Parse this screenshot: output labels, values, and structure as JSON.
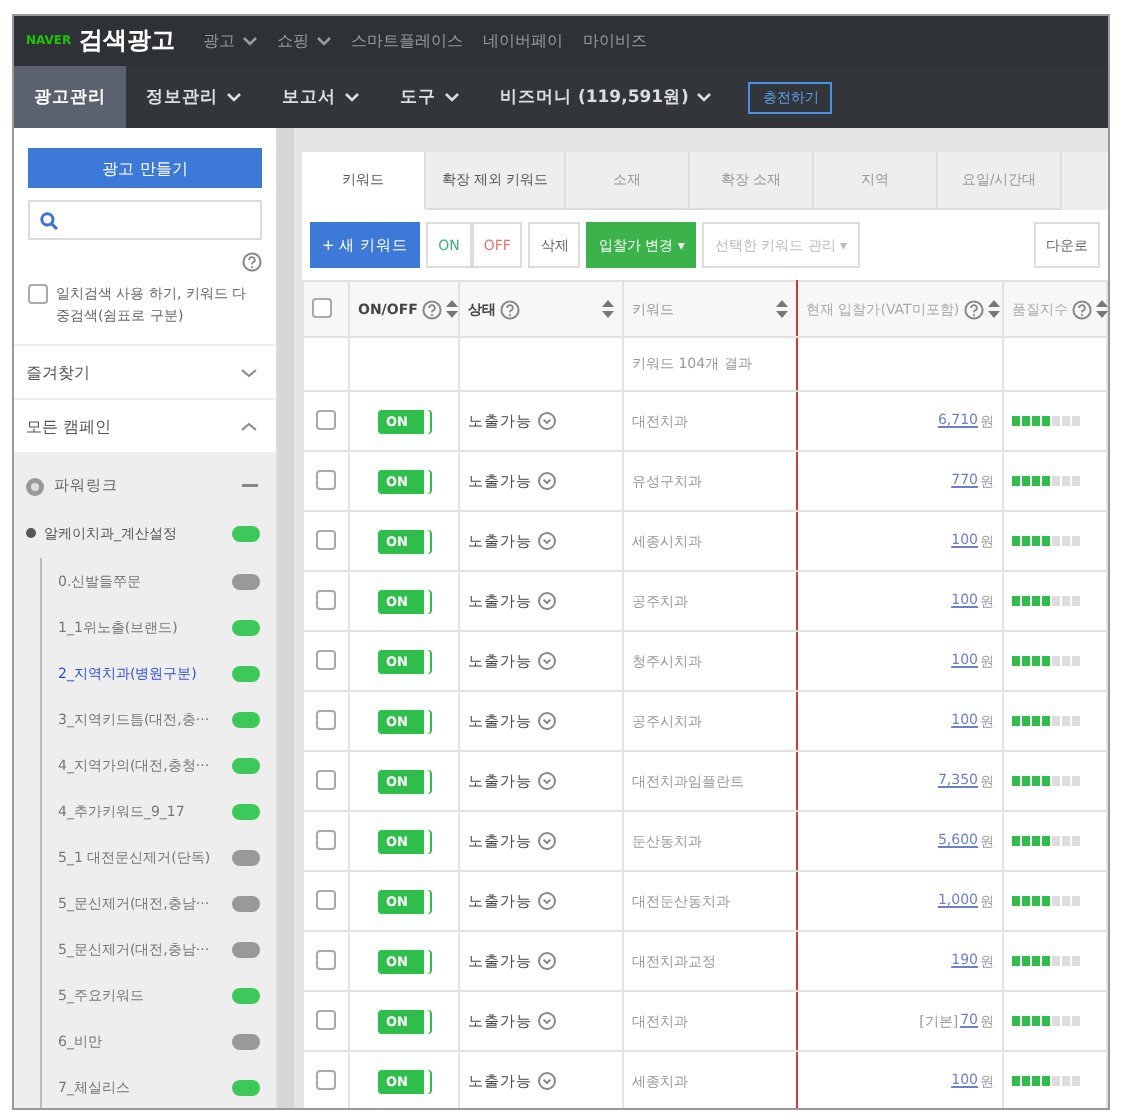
{
  "top_bar": {
    "logo_brand": "NAVER",
    "logo_title": "검색광고",
    "menu": [
      {
        "label": "광고",
        "dropdown": true
      },
      {
        "label": "쇼핑",
        "dropdown": true
      },
      {
        "label": "스마트플레이스",
        "dropdown": false
      },
      {
        "label": "네이버페이",
        "dropdown": false
      },
      {
        "label": "마이비즈",
        "dropdown": false
      }
    ]
  },
  "nav_bar": {
    "items": [
      {
        "label": "광고관리",
        "selected": true,
        "dropdown": false
      },
      {
        "label": "정보관리",
        "selected": false,
        "dropdown": true
      },
      {
        "label": "보고서",
        "selected": false,
        "dropdown": true
      },
      {
        "label": "도구",
        "selected": false,
        "dropdown": true
      },
      {
        "label": "비즈머니 (119,591원)",
        "selected": false,
        "dropdown": true
      }
    ],
    "charge_button": "충전하기"
  },
  "sidebar": {
    "create_button": "광고 만들기",
    "option": {
      "checked": false,
      "label": "일치검색 사용 하기, 키워드 다중검색(쉼표로 구분)"
    },
    "sections": [
      {
        "label": "즐겨찾기",
        "expanded": false
      },
      {
        "label": "모든 캠페인",
        "expanded": true
      }
    ],
    "campaign": {
      "label": "파워링크",
      "expanded": true
    },
    "items": [
      {
        "label": "알케이치과_계산설정",
        "on": true,
        "selected": false,
        "children": [
          {
            "label": "0.신발들쭈문",
            "on": false,
            "selected": false
          },
          {
            "label": "1_1위노출(브랜드)",
            "on": true,
            "selected": false
          },
          {
            "label": "2_지역치과(병원구분)",
            "on": true,
            "selected": true
          },
          {
            "label": "3_지역키드틈(대전,충···",
            "on": true,
            "selected": false
          },
          {
            "label": "4_지역가의(대전,충청···",
            "on": true,
            "selected": false
          },
          {
            "label": "4_추가키워드_9_17",
            "on": true,
            "selected": false
          },
          {
            "label": "5_1 대전문신제거(단독)",
            "on": false,
            "selected": false
          },
          {
            "label": "5_문신제거(대전,충남···",
            "on": false,
            "selected": false
          },
          {
            "label": "5_문신제거(대전,충남···",
            "on": false,
            "selected": false
          },
          {
            "label": "5_주요키워드",
            "on": true,
            "selected": false
          },
          {
            "label": "6_비만",
            "on": false,
            "selected": false
          },
          {
            "label": "7_체실리스",
            "on": true,
            "selected": false
          }
        ]
      }
    ]
  },
  "tabs": [
    {
      "label": "키워드",
      "selected": true
    },
    {
      "label": "확장 제외 키워드",
      "selected": false
    },
    {
      "label": "소재",
      "selected": false
    },
    {
      "label": "확장 소재",
      "selected": false
    },
    {
      "label": "지역",
      "selected": false
    },
    {
      "label": "요일/시간대",
      "selected": false
    }
  ],
  "toolbar": [
    {
      "kind": "primary",
      "label": "+ 새 키워드"
    },
    {
      "kind": "on",
      "label": "ON"
    },
    {
      "kind": "off",
      "label": "OFF"
    },
    {
      "kind": "plain",
      "label": "삭제"
    },
    {
      "kind": "green",
      "label": "입찰가 변경 ▾"
    },
    {
      "kind": "disabled",
      "label": "선택한 키워드 관리 ▾"
    },
    {
      "kind": "plain",
      "label": "다운로"
    }
  ],
  "table": {
    "columns": [
      {
        "label": "ON/OFF",
        "help": true,
        "sort": true,
        "highlighted": false
      },
      {
        "label": "상태",
        "help": true,
        "sort": true,
        "highlighted": false
      },
      {
        "label": "키워드",
        "help": false,
        "sort": true,
        "highlighted": true
      },
      {
        "label": "현재 입찰가(VAT미포함)",
        "help": true,
        "sort": true,
        "highlighted": false
      },
      {
        "label": "품질지수",
        "help": true,
        "sort": true,
        "highlighted": false
      }
    ],
    "summary": "키워드 104개 결과",
    "all_checked": false,
    "rows": [
      {
        "checked": false,
        "on": true,
        "toggle": "ON",
        "status": "노출가능",
        "keyword": "대전치과",
        "bid": "6,710",
        "unit": "원",
        "quality": {
          "level": 0.57
        }
      },
      {
        "checked": false,
        "on": true,
        "toggle": "ON",
        "status": "노출가능",
        "keyword": "유성구치과",
        "bid": "770",
        "unit": "원",
        "quality": {
          "level": 0.57
        }
      },
      {
        "checked": false,
        "on": true,
        "toggle": "ON",
        "status": "노출가능",
        "keyword": "세종시치과",
        "bid": "100",
        "unit": "원",
        "quality": {
          "level": 0.57
        }
      },
      {
        "checked": false,
        "on": true,
        "toggle": "ON",
        "status": "노출가능",
        "keyword": "공주치과",
        "bid": "100",
        "unit": "원",
        "quality": {
          "level": 0.57
        }
      },
      {
        "checked": false,
        "on": true,
        "toggle": "ON",
        "status": "노출가능",
        "keyword": "청주시치과",
        "bid": "100",
        "unit": "원",
        "quality": {
          "level": 0.57
        }
      },
      {
        "checked": false,
        "on": true,
        "toggle": "ON",
        "status": "노출가능",
        "keyword": "공주시치과",
        "bid": "100",
        "unit": "원",
        "quality": {
          "level": 0.57
        }
      },
      {
        "checked": false,
        "on": true,
        "toggle": "ON",
        "status": "노출가능",
        "keyword": "대전치과임플란트",
        "bid": "7,350",
        "unit": "원",
        "quality": {
          "level": 0.57
        }
      },
      {
        "checked": false,
        "on": true,
        "toggle": "ON",
        "status": "노출가능",
        "keyword": "둔산동치과",
        "bid": "5,600",
        "unit": "원",
        "quality": {
          "level": 0.57
        }
      },
      {
        "checked": false,
        "on": true,
        "toggle": "ON",
        "status": "노출가능",
        "keyword": "대전둔산동치과",
        "bid": "1,000",
        "unit": "원",
        "quality": {
          "level": 0.57
        }
      },
      {
        "checked": false,
        "on": true,
        "toggle": "ON",
        "status": "노출가능",
        "keyword": "대전치과교정",
        "bid": "190",
        "unit": "원",
        "quality": {
          "level": 0.57
        }
      },
      {
        "checked": false,
        "on": true,
        "toggle": "ON",
        "status": "노출가능",
        "keyword": "대전치과",
        "bid_prefix": "[기본]",
        "bid": "70",
        "unit": "원",
        "quality": {
          "level": 0.57
        }
      },
      {
        "checked": false,
        "on": true,
        "toggle": "ON",
        "status": "노출가능",
        "keyword": "세종치과",
        "bid": "100",
        "unit": "원",
        "quality": {
          "level": 0.57
        }
      }
    ]
  }
}
